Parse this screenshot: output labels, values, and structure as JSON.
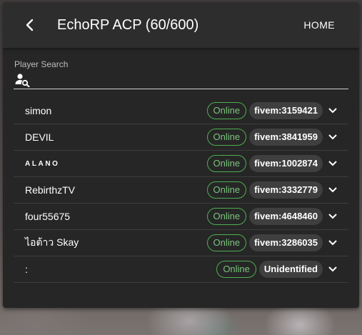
{
  "header": {
    "title": "EchoRP ACP (60/600)",
    "home_label": "HOME"
  },
  "search": {
    "label": "Player Search",
    "value": "",
    "placeholder": ""
  },
  "players": [
    {
      "name": "simon",
      "status": "Online",
      "identifier": "fivem:3159421"
    },
    {
      "name": "DEVIL",
      "status": "Online",
      "identifier": "fivem:3841959"
    },
    {
      "name": "ALANO",
      "status": "Online",
      "identifier": "fivem:1002874"
    },
    {
      "name": "RebirthzTV",
      "status": "Online",
      "identifier": "fivem:3332779"
    },
    {
      "name": "four55675",
      "status": "Online",
      "identifier": "fivem:4648460"
    },
    {
      "name": "ไอต้าว Skay",
      "status": "Online",
      "identifier": "fivem:3286035"
    },
    {
      "name": ":",
      "status": "Online",
      "identifier": "Unidentified"
    }
  ],
  "colors": {
    "panel": "#262626",
    "topbar": "#2d2d2d",
    "online_border": "#4caf50",
    "online_text": "#7cc47f",
    "chip_bg": "#3f3f3f"
  },
  "icons": {
    "back": "chevron-left-icon",
    "search": "person-search-icon",
    "expand": "chevron-down-icon"
  }
}
